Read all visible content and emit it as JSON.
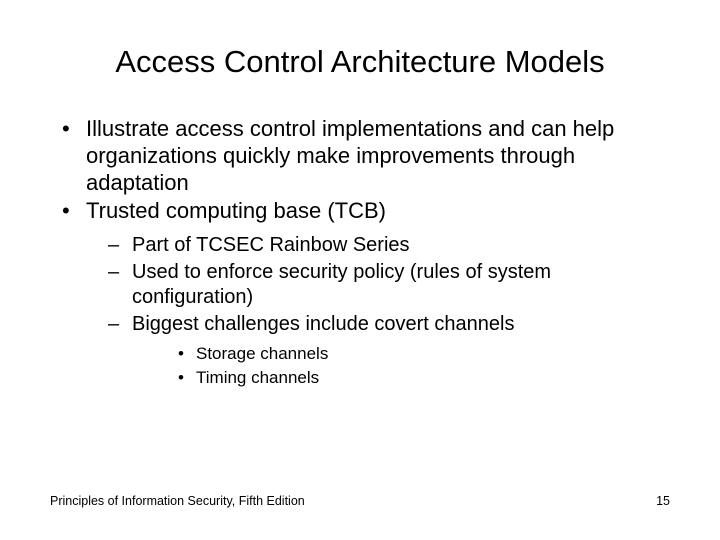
{
  "title": "Access Control Architecture Models",
  "bullets": {
    "b1": "Illustrate access control implementations and can help organizations quickly make improvements through adaptation",
    "b2": "Trusted computing base (TCB)",
    "b2_1": "Part of TCSEC Rainbow Series",
    "b2_2": "Used to enforce security policy (rules of system configuration)",
    "b2_3": "Biggest challenges include covert channels",
    "b2_3_1": "Storage channels",
    "b2_3_2": "Timing channels"
  },
  "footer": {
    "left": "Principles of Information Security, Fifth Edition",
    "right": "15"
  }
}
